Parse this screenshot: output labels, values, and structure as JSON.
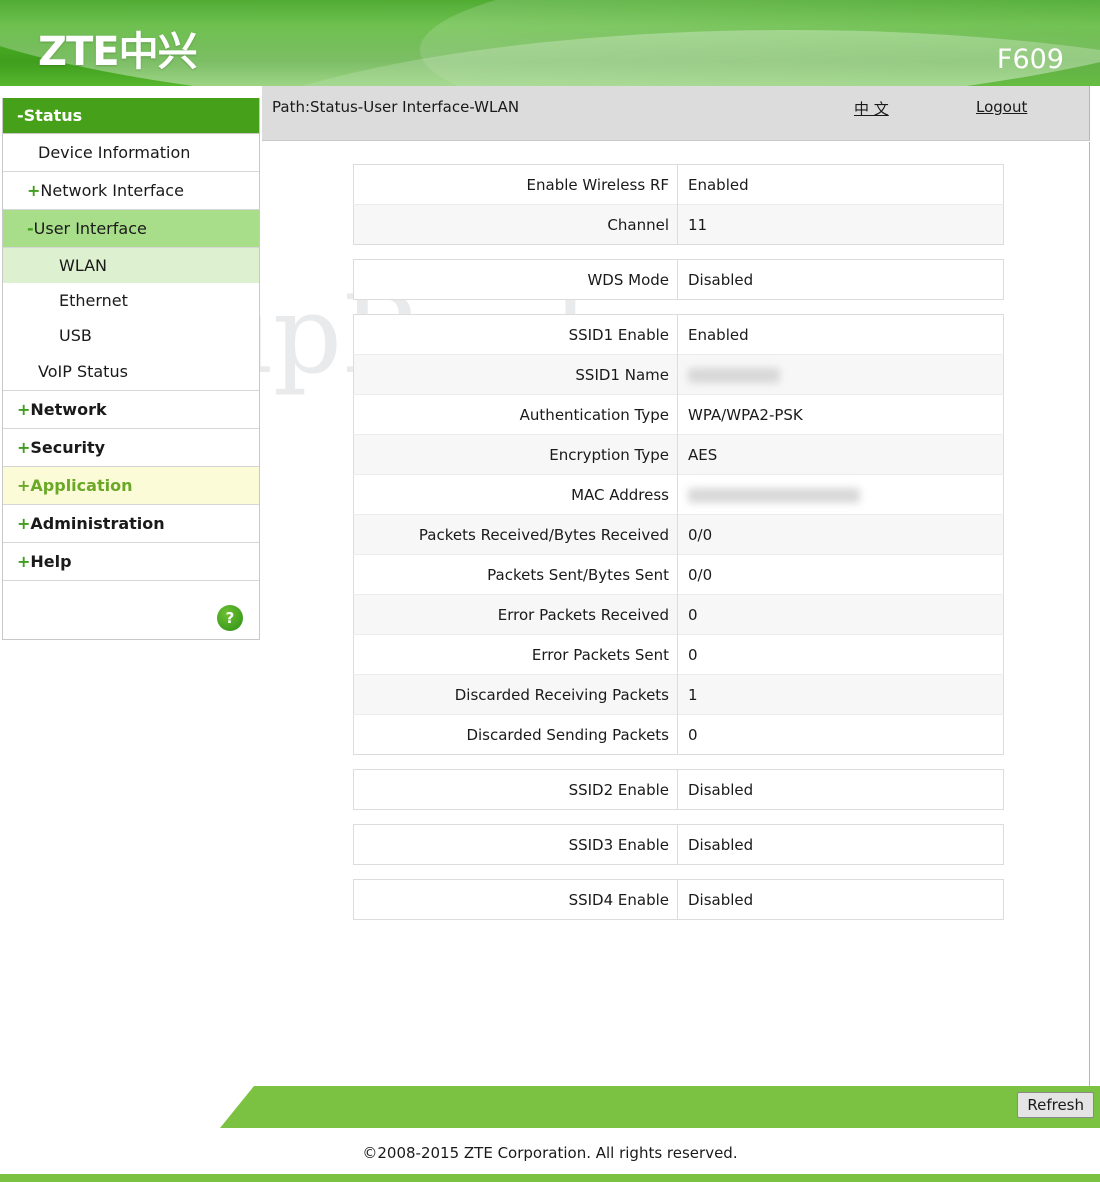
{
  "header": {
    "logo": "ZTE中兴",
    "model": "F609"
  },
  "pathbar": {
    "path": "Path:Status-User Interface-WLAN",
    "language_link": "中 文",
    "logout_link": "Logout"
  },
  "sidebar": {
    "status_header": "-Status",
    "items": [
      {
        "label": "Device Information",
        "level": 1,
        "prefix": "",
        "state": "normal"
      },
      {
        "label": "Network Interface",
        "level": 2,
        "prefix": "+",
        "state": "normal"
      },
      {
        "label": "User Interface",
        "level": 2,
        "prefix": "-",
        "state": "active"
      },
      {
        "label": "WLAN",
        "level": 3,
        "prefix": "",
        "state": "active"
      },
      {
        "label": "Ethernet",
        "level": 3,
        "prefix": "",
        "state": "normal"
      },
      {
        "label": "USB",
        "level": 3,
        "prefix": "",
        "state": "normal"
      },
      {
        "label": "VoIP Status",
        "level": 1,
        "prefix": "",
        "state": "normal"
      },
      {
        "label": "Network",
        "level": 1,
        "prefix": "+",
        "state": "normal"
      },
      {
        "label": "Security",
        "level": 1,
        "prefix": "+",
        "state": "normal"
      },
      {
        "label": "Application",
        "level": 1,
        "prefix": "+",
        "state": "hovered"
      },
      {
        "label": "Administration",
        "level": 1,
        "prefix": "+",
        "state": "normal"
      },
      {
        "label": "Help",
        "level": 1,
        "prefix": "+",
        "state": "normal"
      }
    ],
    "help_icon": "?"
  },
  "tables": [
    {
      "name": "radio-settings",
      "rows": [
        {
          "key": "Enable Wireless RF",
          "value": "Enabled",
          "redacted": ""
        },
        {
          "key": "Channel",
          "value": "11",
          "redacted": ""
        }
      ]
    },
    {
      "name": "wds-settings",
      "rows": [
        {
          "key": "WDS Mode",
          "value": "Disabled",
          "redacted": ""
        }
      ]
    },
    {
      "name": "ssid1-details",
      "rows": [
        {
          "key": "SSID1 Enable",
          "value": "Enabled",
          "redacted": ""
        },
        {
          "key": "SSID1 Name",
          "value": "",
          "redacted": "ssid"
        },
        {
          "key": "Authentication Type",
          "value": "WPA/WPA2-PSK",
          "redacted": ""
        },
        {
          "key": "Encryption Type",
          "value": "AES",
          "redacted": ""
        },
        {
          "key": "MAC Address",
          "value": "",
          "redacted": "mac"
        },
        {
          "key": "Packets Received/Bytes Received",
          "value": "0/0",
          "redacted": ""
        },
        {
          "key": "Packets Sent/Bytes Sent",
          "value": "0/0",
          "redacted": ""
        },
        {
          "key": "Error Packets Received",
          "value": "0",
          "redacted": ""
        },
        {
          "key": "Error Packets Sent",
          "value": "0",
          "redacted": ""
        },
        {
          "key": "Discarded Receiving Packets",
          "value": "1",
          "redacted": ""
        },
        {
          "key": "Discarded Sending Packets",
          "value": "0",
          "redacted": ""
        }
      ]
    },
    {
      "name": "ssid2-details",
      "rows": [
        {
          "key": "SSID2 Enable",
          "value": "Disabled",
          "redacted": ""
        }
      ]
    },
    {
      "name": "ssid3-details",
      "rows": [
        {
          "key": "SSID3 Enable",
          "value": "Disabled",
          "redacted": ""
        }
      ]
    },
    {
      "name": "ssid4-details",
      "rows": [
        {
          "key": "SSID4 Enable",
          "value": "Disabled",
          "redacted": ""
        }
      ]
    }
  ],
  "footer": {
    "refresh_label": "Refresh",
    "copyright": "©2008-2015 ZTE Corporation. All rights reserved."
  },
  "watermark": {
    "text": "SetupRouter.com"
  },
  "colors": {
    "brand_green": "#46a019",
    "band_green": "#7cc242",
    "active_green": "#a8dd8a",
    "subactive_green": "#ddf0cf",
    "hover_yellow": "#fcfbd8",
    "pathbar_gray": "#dcdcdc"
  }
}
